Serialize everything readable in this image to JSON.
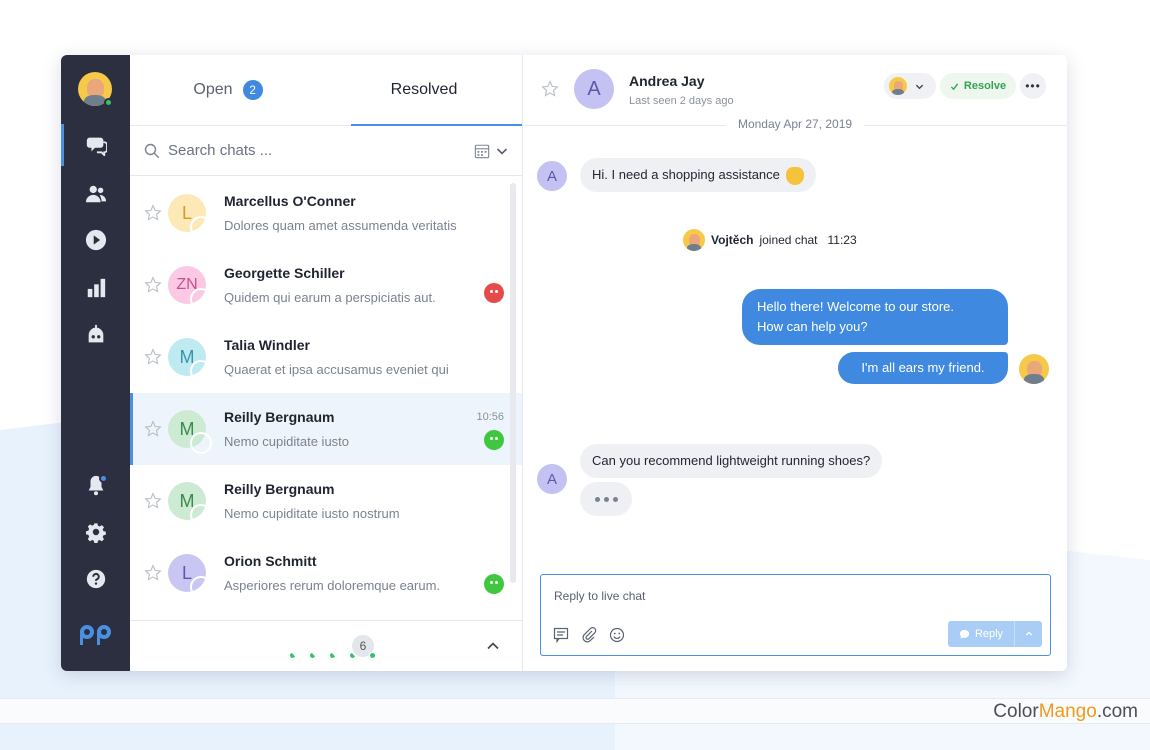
{
  "tabs": [
    {
      "label": "Open",
      "badge": "2"
    },
    {
      "label": "Resolved"
    }
  ],
  "search": {
    "placeholder": "Search chats ..."
  },
  "chats": [
    {
      "initial": "L",
      "name": "Marcellus O'Conner",
      "preview": "Dolores quam amet assumenda veritatis",
      "color": "#fde9b6",
      "text_color": "#d29b2c",
      "time": "",
      "mood": ""
    },
    {
      "initial": "ZN",
      "name": "Georgette Schiller",
      "preview": "Quidem qui earum a perspiciatis aut.",
      "color": "#fbc9e3",
      "text_color": "#c8508f",
      "time": "",
      "mood": "angry"
    },
    {
      "initial": "M",
      "name": "Talia Windler",
      "preview": "Quaerat et ipsa accusamus eveniet qui",
      "color": "#bfeaf2",
      "text_color": "#3796a8",
      "time": "",
      "mood": ""
    },
    {
      "initial": "M",
      "name": "Reilly Bergnaum",
      "preview": "Nemo cupiditate iusto",
      "color": "#cdebd3",
      "text_color": "#3a8b4c",
      "time": "10:56",
      "mood": "happy"
    },
    {
      "initial": "M",
      "name": "Reilly Bergnaum",
      "preview": "Nemo cupiditate iusto nostrum",
      "color": "#cdebd3",
      "text_color": "#3a8b4c",
      "time": "",
      "mood": ""
    },
    {
      "initial": "L",
      "name": "Orion Schmitt",
      "preview": "Asperiores rerum doloremque earum.",
      "color": "#c9c6f3",
      "text_color": "#5c5aa8",
      "time": "",
      "mood": "happy"
    }
  ],
  "agents": {
    "more_count": "6"
  },
  "conversation": {
    "customer_initial": "A",
    "customer_name": "Andrea Jay",
    "last_seen": "Last seen 2 days ago",
    "resolve_label": "Resolve",
    "more_label": "•••",
    "date": "Monday Apr 27, 2019",
    "msg1": "Hi. I need a shopping assistance",
    "join_name": "Vojtěch",
    "join_text": "joined chat",
    "join_time": "11:23",
    "out1_line1": "Hello there! Welcome to our store.",
    "out1_line2": "How can help you?",
    "out2": "I'm all ears my friend.",
    "msg2": "Can you recommend lightweight running shoes?"
  },
  "composer": {
    "placeholder": "Reply to live chat",
    "reply_label": "Reply"
  },
  "watermark": {
    "part1": "Color",
    "part2": "Mango",
    "part3": ".com"
  },
  "colors": {
    "accent": "#3f8ae0",
    "rail": "#2b2f3f",
    "resolve_green": "#33a457"
  }
}
